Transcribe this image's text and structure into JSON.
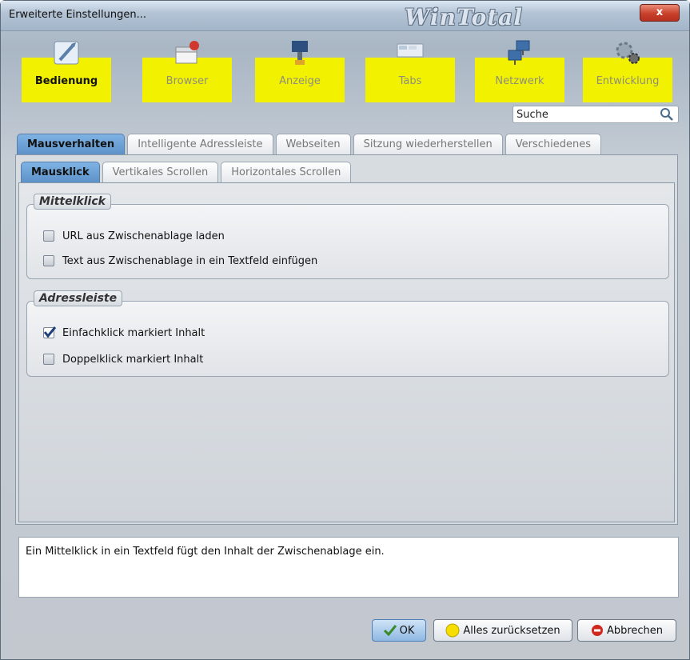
{
  "window": {
    "title": "Erweiterte Einstellungen...",
    "brand": "WinTotal",
    "close_label": "x"
  },
  "toolbar": {
    "items": [
      {
        "label": "Bedienung",
        "icon": "pointer-icon",
        "active": true
      },
      {
        "label": "Browser",
        "icon": "browser-icon",
        "active": false
      },
      {
        "label": "Anzeige",
        "icon": "paint-icon",
        "active": false
      },
      {
        "label": "Tabs",
        "icon": "tabs-icon",
        "active": false
      },
      {
        "label": "Netzwerk",
        "icon": "network-icon",
        "active": false
      },
      {
        "label": "Entwicklung",
        "icon": "gear-icon",
        "active": false
      }
    ],
    "highlight_color": "#f2f200"
  },
  "search": {
    "value": "Suche"
  },
  "tabs_primary": [
    {
      "label": "Mausverhalten",
      "active": true
    },
    {
      "label": "Intelligente Adressleiste",
      "active": false
    },
    {
      "label": "Webseiten",
      "active": false
    },
    {
      "label": "Sitzung wiederherstellen",
      "active": false
    },
    {
      "label": "Verschiedenes",
      "active": false
    }
  ],
  "tabs_secondary": [
    {
      "label": "Mausklick",
      "active": true
    },
    {
      "label": "Vertikales Scrollen",
      "active": false
    },
    {
      "label": "Horizontales Scrollen",
      "active": false
    }
  ],
  "groups": [
    {
      "title": "Mittelklick",
      "options": [
        {
          "label": "URL aus Zwischenablage laden",
          "checked": false
        },
        {
          "label": "Text aus Zwischenablage in ein Textfeld einfügen",
          "checked": false
        }
      ]
    },
    {
      "title": "Adressleiste",
      "options": [
        {
          "label": "Einfachklick markiert Inhalt",
          "checked": true
        },
        {
          "label": "Doppelklick markiert Inhalt",
          "checked": false
        }
      ]
    }
  ],
  "description": "Ein Mittelklick in ein Textfeld fügt den Inhalt der Zwischenablage ein.",
  "buttons": {
    "ok": "OK",
    "reset": "Alles zurücksetzen",
    "cancel": "Abbrechen"
  }
}
